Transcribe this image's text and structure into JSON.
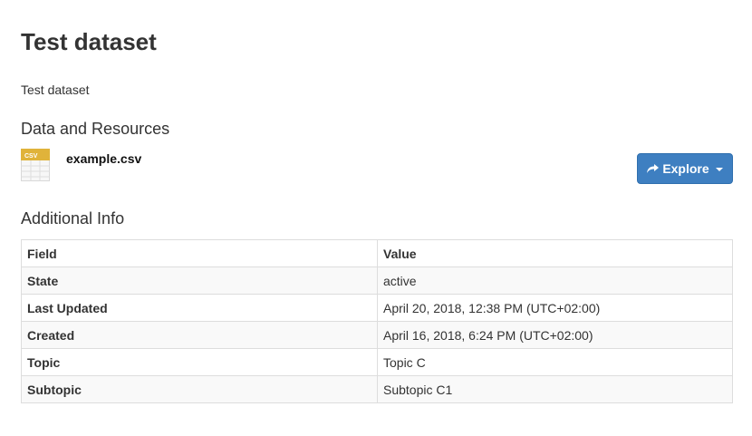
{
  "page": {
    "title": "Test dataset",
    "notes": "Test dataset"
  },
  "resources": {
    "heading": "Data and Resources",
    "items": [
      {
        "format": "CSV",
        "icon": "csv-file-icon",
        "title": "example.csv",
        "explore_label": "Explore"
      }
    ]
  },
  "additional_info": {
    "heading": "Additional Info",
    "columns": [
      "Field",
      "Value"
    ],
    "rows": [
      {
        "field": "State",
        "value": "active"
      },
      {
        "field": "Last Updated",
        "value": "April 20, 2018, 12:38 PM (UTC+02:00)"
      },
      {
        "field": "Created",
        "value": "April 16, 2018, 6:24 PM (UTC+02:00)"
      },
      {
        "field": "Topic",
        "value": "Topic C"
      },
      {
        "field": "Subtopic",
        "value": "Subtopic C1"
      }
    ]
  },
  "colors": {
    "button": "#3e7fc1",
    "csv_icon": "#e0b33a"
  }
}
